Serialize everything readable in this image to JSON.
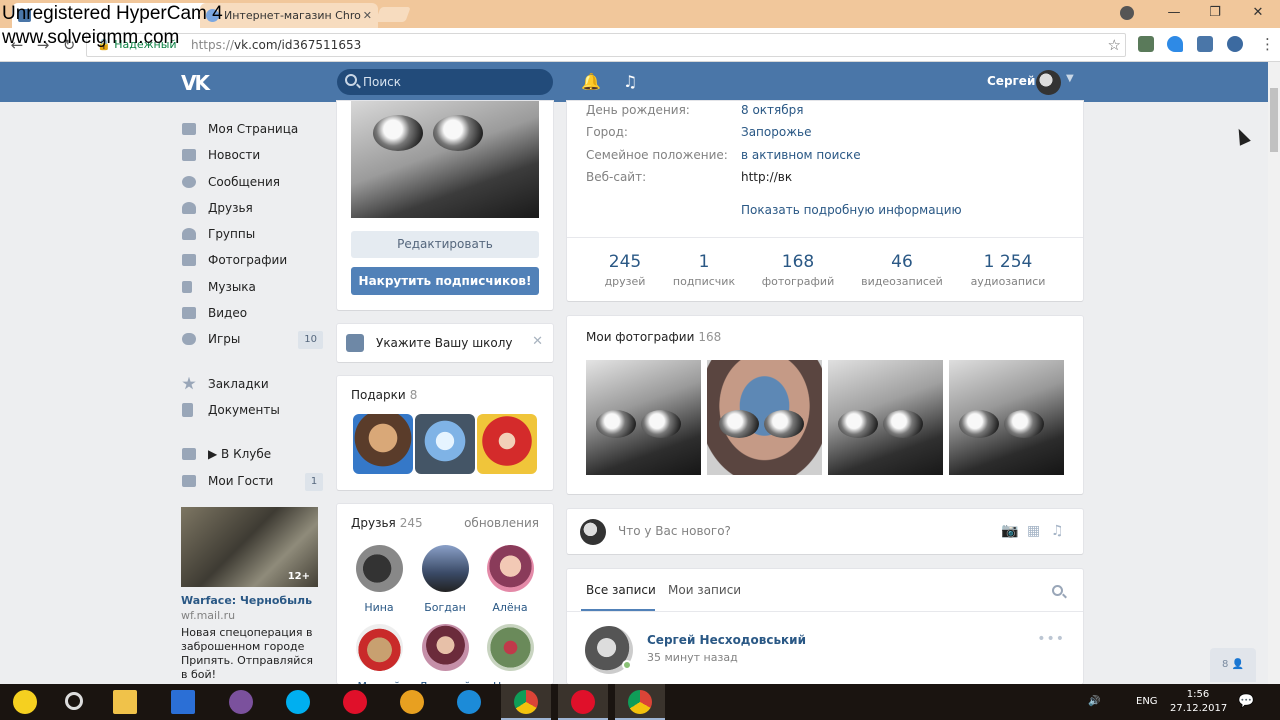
{
  "watermark": {
    "line1": "Unregistered HyperCam 4",
    "line2": "www.solveigmm.com"
  },
  "browser": {
    "tabs": [
      {
        "label": ""
      },
      {
        "label": "Интернет-магазин Chro"
      }
    ],
    "tab_close": "✕",
    "win_minimize": "—",
    "win_restore": "❐",
    "win_close": "✕",
    "secure_label": "Надежный",
    "url_scheme": "https://",
    "url_rest": "vk.com/id367511653"
  },
  "vk": {
    "logo": "VK",
    "search_placeholder": "Поиск",
    "user_name": "Сергей"
  },
  "left_nav": {
    "items": [
      {
        "label": "Моя Страница"
      },
      {
        "label": "Новости"
      },
      {
        "label": "Сообщения"
      },
      {
        "label": "Друзья"
      },
      {
        "label": "Группы"
      },
      {
        "label": "Фотографии"
      },
      {
        "label": "Музыка"
      },
      {
        "label": "Видео"
      },
      {
        "label": "Игры",
        "count": "10"
      }
    ],
    "items2": [
      {
        "label": "Закладки"
      },
      {
        "label": "Документы"
      }
    ],
    "items3": [
      {
        "label": "▶ В Клубе"
      },
      {
        "label": "Мои Гости",
        "count": "1"
      }
    ]
  },
  "ad": {
    "age": "12+",
    "title": "Warface: Чернобыль",
    "domain": "wf.mail.ru",
    "text": "Новая спецоперация в заброшенном городе Припять. Отправляйся в бой!"
  },
  "profile": {
    "edit_label": "Редактировать",
    "boost_label": "Накрутить подписчиков!",
    "school_prompt": "Укажите Вашу школу",
    "gifts_title": "Подарки",
    "gifts_count": "8",
    "friends_title": "Друзья",
    "friends_count": "245",
    "friends_link": "обновления",
    "friends": [
      {
        "name": "Нина"
      },
      {
        "name": "Богдан"
      },
      {
        "name": "Алёна"
      },
      {
        "name": "Матвей"
      },
      {
        "name": "Дмитрий"
      },
      {
        "name": "Настя"
      }
    ]
  },
  "info": {
    "rows": [
      {
        "key": "День рождения:",
        "value": "8 октября"
      },
      {
        "key": "Город:",
        "value": "Запорожье"
      },
      {
        "key": "Семейное положение:",
        "value": "в активном поиске"
      },
      {
        "key": "Веб-сайт:",
        "value": "http://вк"
      }
    ],
    "show_more": "Показать подробную информацию",
    "counters": [
      {
        "value": "245",
        "label": "друзей"
      },
      {
        "value": "1",
        "label": "подписчик"
      },
      {
        "value": "168",
        "label": "фотографий"
      },
      {
        "value": "46",
        "label": "видеозаписей"
      },
      {
        "value": "1 254",
        "label": "аудиозаписи"
      }
    ]
  },
  "photos": {
    "title": "Мои фотографии",
    "count": "168"
  },
  "post": {
    "placeholder": "Что у Вас нового?"
  },
  "wall": {
    "tab_all": "Все записи",
    "tab_mine": "Мои записи",
    "author": "Сергей Несходовський",
    "time": "35 минут назад",
    "more": "•••"
  },
  "chat_widget": {
    "count": "8"
  },
  "taskbar": {
    "lang": "ENG",
    "time": "1:56",
    "date": "27.12.2017"
  },
  "colors": {
    "vk_header": "#4a76a8",
    "vk_link": "#2a5885",
    "vk_button": "#5181b8",
    "page_bg": "#edeef0"
  }
}
